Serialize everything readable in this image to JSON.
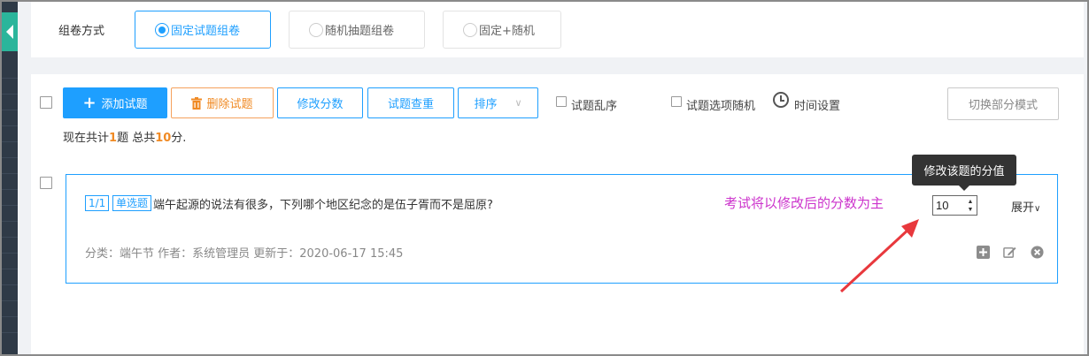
{
  "header": {
    "method_label": "组卷方式",
    "options": [
      "固定试题组卷",
      "随机抽题组卷",
      "固定+随机"
    ],
    "selected_index": 0
  },
  "toolbar": {
    "add_label": "添加试题",
    "delete_label": "删除试题",
    "edit_score_label": "修改分数",
    "dedupe_label": "试题查重",
    "sort_label": "排序",
    "shuffle_questions_label": "试题乱序",
    "shuffle_options_label": "试题选项随机",
    "time_setting_label": "时间设置",
    "switch_mode_label": "切换部分模式"
  },
  "summary": {
    "prefix": "现在共计",
    "question_count": "1",
    "middle": "题 总共",
    "total_score": "10",
    "suffix": "分."
  },
  "question": {
    "index_tag": "1/1",
    "type_tag": "单选题",
    "text": "端午起源的说法有很多，下列哪个地区纪念的是伍子胥而不是屈原?",
    "annotation": "考试将以修改后的分数为主",
    "tooltip": "修改该题的分值",
    "score_value": "10",
    "expand_label": "展开",
    "meta": "分类：端午节   作者：系统管理员   更新于：2020-06-17 15:45"
  },
  "icons": {
    "add": "plus-square-icon",
    "edit": "edit-icon",
    "remove": "close-circle-icon",
    "clock": "clock-icon",
    "trash": "trash-icon"
  },
  "colors": {
    "primary": "#1e9fff",
    "warning": "#f08a24",
    "annotation": "#cc33cc",
    "arrow": "#e8383d"
  }
}
